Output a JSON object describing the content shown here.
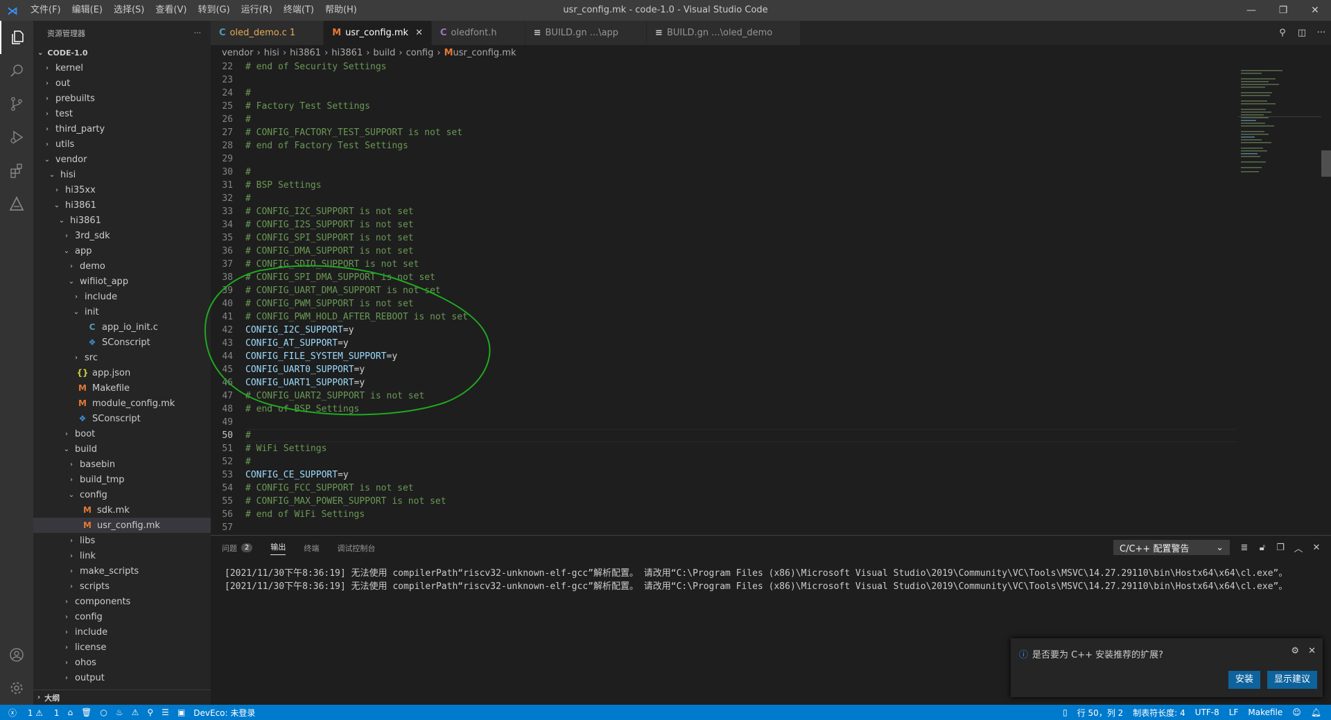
{
  "titlebar": {
    "menu": [
      "文件(F)",
      "编辑(E)",
      "选择(S)",
      "查看(V)",
      "转到(G)",
      "运行(R)",
      "终端(T)",
      "帮助(H)"
    ],
    "title": "usr_config.mk - code-1.0 - Visual Studio Code"
  },
  "sidebar": {
    "title": "资源管理器",
    "more": "···",
    "root": "CODE-1.0",
    "outline": "大纲",
    "tree": [
      {
        "label": "kernel",
        "depth": 0,
        "twisty": "›",
        "icon": ""
      },
      {
        "label": "out",
        "depth": 0,
        "twisty": "›",
        "icon": ""
      },
      {
        "label": "prebuilts",
        "depth": 0,
        "twisty": "›",
        "icon": ""
      },
      {
        "label": "test",
        "depth": 0,
        "twisty": "›",
        "icon": ""
      },
      {
        "label": "third_party",
        "depth": 0,
        "twisty": "›",
        "icon": ""
      },
      {
        "label": "utils",
        "depth": 0,
        "twisty": "›",
        "icon": ""
      },
      {
        "label": "vendor",
        "depth": 0,
        "twisty": "⌄",
        "icon": ""
      },
      {
        "label": "hisi",
        "depth": 1,
        "twisty": "⌄",
        "icon": ""
      },
      {
        "label": "hi35xx",
        "depth": 2,
        "twisty": "›",
        "icon": ""
      },
      {
        "label": "hi3861",
        "depth": 2,
        "twisty": "⌄",
        "icon": ""
      },
      {
        "label": "hi3861",
        "depth": 3,
        "twisty": "⌄",
        "icon": ""
      },
      {
        "label": "3rd_sdk",
        "depth": 4,
        "twisty": "›",
        "icon": ""
      },
      {
        "label": "app",
        "depth": 4,
        "twisty": "⌄",
        "icon": ""
      },
      {
        "label": "demo",
        "depth": 5,
        "twisty": "›",
        "icon": ""
      },
      {
        "label": "wifiiot_app",
        "depth": 5,
        "twisty": "⌄",
        "icon": ""
      },
      {
        "label": "include",
        "depth": 6,
        "twisty": "›",
        "icon": ""
      },
      {
        "label": "init",
        "depth": 6,
        "twisty": "⌄",
        "icon": ""
      },
      {
        "label": "app_io_init.c",
        "depth": 7,
        "twisty": "",
        "icon": "C",
        "iconColor": "#519aba"
      },
      {
        "label": "SConscript",
        "depth": 7,
        "twisty": "",
        "icon": "❖",
        "iconColor": "#3d8fd1"
      },
      {
        "label": "src",
        "depth": 6,
        "twisty": "›",
        "icon": ""
      },
      {
        "label": "app.json",
        "depth": 5,
        "twisty": "",
        "icon": "{}",
        "iconColor": "#cbcb41"
      },
      {
        "label": "Makefile",
        "depth": 5,
        "twisty": "",
        "icon": "M",
        "iconColor": "#e37933"
      },
      {
        "label": "module_config.mk",
        "depth": 5,
        "twisty": "",
        "icon": "M",
        "iconColor": "#e37933"
      },
      {
        "label": "SConscript",
        "depth": 5,
        "twisty": "",
        "icon": "❖",
        "iconColor": "#3d8fd1"
      },
      {
        "label": "boot",
        "depth": 4,
        "twisty": "›",
        "icon": ""
      },
      {
        "label": "build",
        "depth": 4,
        "twisty": "⌄",
        "icon": ""
      },
      {
        "label": "basebin",
        "depth": 5,
        "twisty": "›",
        "icon": ""
      },
      {
        "label": "build_tmp",
        "depth": 5,
        "twisty": "›",
        "icon": ""
      },
      {
        "label": "config",
        "depth": 5,
        "twisty": "⌄",
        "icon": ""
      },
      {
        "label": "sdk.mk",
        "depth": 6,
        "twisty": "",
        "icon": "M",
        "iconColor": "#e37933"
      },
      {
        "label": "usr_config.mk",
        "depth": 6,
        "twisty": "",
        "icon": "M",
        "iconColor": "#e37933",
        "selected": true
      },
      {
        "label": "libs",
        "depth": 5,
        "twisty": "›",
        "icon": ""
      },
      {
        "label": "link",
        "depth": 5,
        "twisty": "›",
        "icon": ""
      },
      {
        "label": "make_scripts",
        "depth": 5,
        "twisty": "›",
        "icon": ""
      },
      {
        "label": "scripts",
        "depth": 5,
        "twisty": "›",
        "icon": ""
      },
      {
        "label": "components",
        "depth": 4,
        "twisty": "›",
        "icon": ""
      },
      {
        "label": "config",
        "depth": 4,
        "twisty": "›",
        "icon": ""
      },
      {
        "label": "include",
        "depth": 4,
        "twisty": "›",
        "icon": ""
      },
      {
        "label": "license",
        "depth": 4,
        "twisty": "›",
        "icon": ""
      },
      {
        "label": "ohos",
        "depth": 4,
        "twisty": "›",
        "icon": ""
      },
      {
        "label": "output",
        "depth": 4,
        "twisty": "›",
        "icon": ""
      }
    ]
  },
  "tabs": [
    {
      "label": "oled_demo.c 1",
      "icon": "C",
      "iconColor": "#519aba",
      "active": false,
      "labelColor": "#e8ab53"
    },
    {
      "label": "usr_config.mk",
      "icon": "M",
      "iconColor": "#e37933",
      "active": true,
      "close": "✕"
    },
    {
      "label": "oledfont.h",
      "icon": "C",
      "iconColor": "#a074c4",
      "active": false
    },
    {
      "label": "BUILD.gn ...\\app",
      "icon": "≡",
      "iconColor": "#ccc",
      "active": false
    },
    {
      "label": "BUILD.gn ...\\oled_demo",
      "icon": "≡",
      "iconColor": "#ccc",
      "active": false
    }
  ],
  "breadcrumb": [
    "vendor",
    "hisi",
    "hi3861",
    "hi3861",
    "build",
    "config",
    "usr_config.mk"
  ],
  "editor": {
    "current_line": 50,
    "lines": [
      {
        "n": 22,
        "t": "# end of Security Settings",
        "c": "c"
      },
      {
        "n": 23,
        "t": "",
        "c": "c"
      },
      {
        "n": 24,
        "t": "#",
        "c": "c"
      },
      {
        "n": 25,
        "t": "# Factory Test Settings",
        "c": "c"
      },
      {
        "n": 26,
        "t": "#",
        "c": "c"
      },
      {
        "n": 27,
        "t": "# CONFIG_FACTORY_TEST_SUPPORT is not set",
        "c": "c"
      },
      {
        "n": 28,
        "t": "# end of Factory Test Settings",
        "c": "c"
      },
      {
        "n": 29,
        "t": "",
        "c": "c"
      },
      {
        "n": 30,
        "t": "#",
        "c": "c"
      },
      {
        "n": 31,
        "t": "# BSP Settings",
        "c": "c"
      },
      {
        "n": 32,
        "t": "#",
        "c": "c"
      },
      {
        "n": 33,
        "t": "# CONFIG_I2C_SUPPORT is not set",
        "c": "c"
      },
      {
        "n": 34,
        "t": "# CONFIG_I2S_SUPPORT is not set",
        "c": "c"
      },
      {
        "n": 35,
        "t": "# CONFIG_SPI_SUPPORT is not set",
        "c": "c"
      },
      {
        "n": 36,
        "t": "# CONFIG_DMA_SUPPORT is not set",
        "c": "c"
      },
      {
        "n": 37,
        "t": "# CONFIG_SDIO_SUPPORT is not set",
        "c": "c"
      },
      {
        "n": 38,
        "t": "# CONFIG_SPI_DMA_SUPPORT is not set",
        "c": "c"
      },
      {
        "n": 39,
        "t": "# CONFIG_UART_DMA_SUPPORT is not set",
        "c": "c"
      },
      {
        "n": 40,
        "t": "# CONFIG_PWM_SUPPORT is not set",
        "c": "c"
      },
      {
        "n": 41,
        "t": "# CONFIG_PWM_HOLD_AFTER_REBOOT is not set",
        "c": "c"
      },
      {
        "n": 42,
        "t": "CONFIG_I2C_SUPPORT",
        "v": "y",
        "c": "k"
      },
      {
        "n": 43,
        "t": "CONFIG_AT_SUPPORT",
        "v": "y",
        "c": "k"
      },
      {
        "n": 44,
        "t": "CONFIG_FILE_SYSTEM_SUPPORT",
        "v": "y",
        "c": "k"
      },
      {
        "n": 45,
        "t": "CONFIG_UART0_SUPPORT",
        "v": "y",
        "c": "k"
      },
      {
        "n": 46,
        "t": "CONFIG_UART1_SUPPORT",
        "v": "y",
        "c": "k"
      },
      {
        "n": 47,
        "t": "# CONFIG_UART2_SUPPORT is not set",
        "c": "c"
      },
      {
        "n": 48,
        "t": "# end of BSP Settings",
        "c": "c"
      },
      {
        "n": 49,
        "t": "",
        "c": "c"
      },
      {
        "n": 50,
        "t": "#",
        "c": "c"
      },
      {
        "n": 51,
        "t": "# WiFi Settings",
        "c": "c"
      },
      {
        "n": 52,
        "t": "#",
        "c": "c"
      },
      {
        "n": 53,
        "t": "CONFIG_CE_SUPPORT",
        "v": "y",
        "c": "k"
      },
      {
        "n": 54,
        "t": "# CONFIG_FCC_SUPPORT is not set",
        "c": "c"
      },
      {
        "n": 55,
        "t": "# CONFIG_MAX_POWER_SUPPORT is not set",
        "c": "c"
      },
      {
        "n": 56,
        "t": "# end of WiFi Settings",
        "c": "c"
      },
      {
        "n": 57,
        "t": "",
        "c": "c"
      }
    ]
  },
  "panel": {
    "tabs": [
      {
        "label": "问题",
        "badge": "2"
      },
      {
        "label": "输出",
        "active": true
      },
      {
        "label": "终端"
      },
      {
        "label": "调试控制台"
      }
    ],
    "select": "C/C++ 配置警告",
    "output": [
      "[2021/11/30下午8:36:19] 无法使用 compilerPath“riscv32-unknown-elf-gcc”解析配置。 请改用“C:\\Program Files (x86)\\Microsoft Visual Studio\\2019\\Community\\VC\\Tools\\MSVC\\14.27.29110\\bin\\Hostx64\\x64\\cl.exe”。",
      "[2021/11/30下午8:36:19] 无法使用 compilerPath“riscv32-unknown-elf-gcc”解析配置。 请改用“C:\\Program Files (x86)\\Microsoft Visual Studio\\2019\\Community\\VC\\Tools\\MSVC\\14.27.29110\\bin\\Hostx64\\x64\\cl.exe”。"
    ]
  },
  "notification": {
    "message": "是否要为 C++ 安装推荐的扩展?",
    "install": "安装",
    "show": "显示建议"
  },
  "statusbar": {
    "errors": "1",
    "warnings": "1",
    "deveco": "DevEco: 未登录",
    "position": "行 50，列 2",
    "tabsize": "制表符长度: 4",
    "encoding": "UTF-8",
    "eol": "LF",
    "language": "Makefile"
  },
  "colors": {
    "accent": "#007acc",
    "annotation": "#1faa1f"
  }
}
